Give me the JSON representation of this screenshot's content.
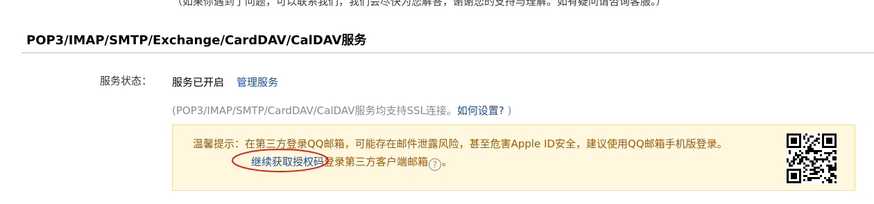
{
  "top_cut_text": "（如果你遇到了问题，可以联系我们，我们会尽快为您解答，谢谢您的支持与理解。如有疑问请咨询客服。）",
  "section": {
    "title": "POP3/IMAP/SMTP/Exchange/CardDAV/CalDAV服务"
  },
  "service": {
    "label": "服务状态：",
    "status": "服务已开启",
    "manage_link": "管理服务"
  },
  "ssl_note": {
    "prefix": "(POP3/IMAP/SMTP/CardDAV/CalDAV服务均支持SSL连接。",
    "link": "如何设置?",
    "suffix": " )"
  },
  "notice": {
    "line1": "温馨提示：在第三方登录QQ邮箱，可能存在邮件泄露风险，甚至危害Apple ID安全，建议使用QQ邮箱手机版登录。",
    "auth_link": "继续获取授权码",
    "line2_suffix": "登录第三方客户端邮箱",
    "help_glyph": "?",
    "end_punct": "。"
  },
  "colors": {
    "link": "#1d4f95",
    "notice_bg": "#fff8de",
    "notice_text": "#9a5a10",
    "annotation_circle": "#e0201a"
  },
  "icons": {
    "qr": "qr-code-icon",
    "help": "help-circle-icon"
  }
}
